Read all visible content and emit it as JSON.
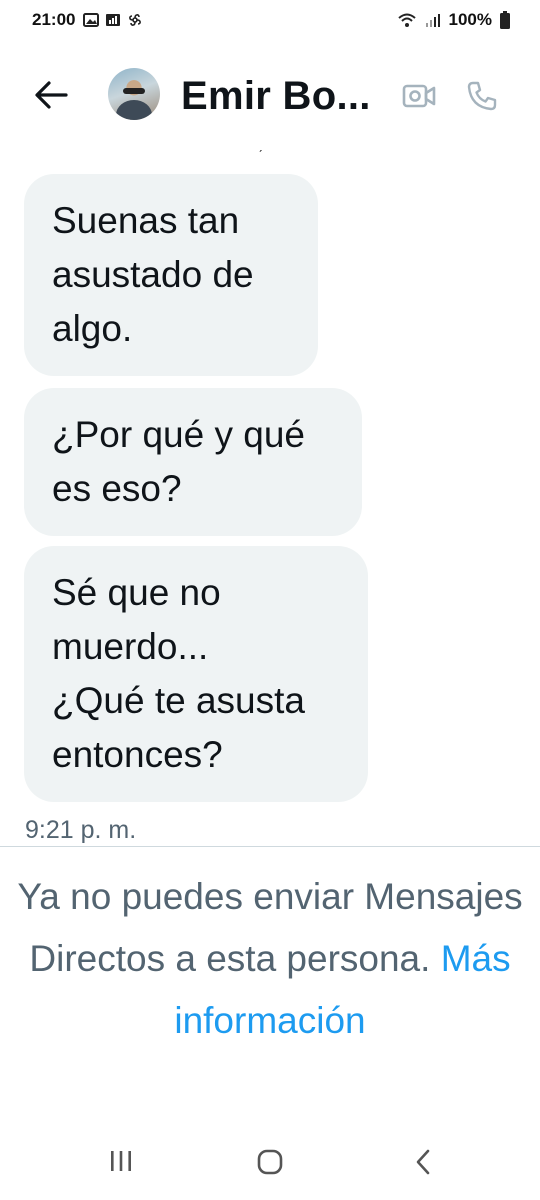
{
  "status_bar": {
    "time": "21:00",
    "battery": "100%",
    "left_icons": [
      "image-icon",
      "signal-bars-icon",
      "pinwheel-icon"
    ],
    "right_icons": [
      "wifi-icon",
      "signal-icon",
      "battery-icon"
    ]
  },
  "header": {
    "contact_name": "Emir Bo...",
    "icons": [
      "back-arrow-icon",
      "avatar",
      "video-call-icon",
      "phone-call-icon"
    ]
  },
  "messages": [
    {
      "text": "Suenas tan\nasustado de\nalgo."
    },
    {
      "text": "¿Por qué y qué\nes eso?"
    },
    {
      "text": "Sé que no\nmuerdo...\n¿Qué te asusta\nentonces?"
    }
  ],
  "timestamp": "9:21 p. m.",
  "notice": {
    "text": "Ya no puedes enviar Mensajes Directos a esta persona.",
    "link": "Más información"
  },
  "colors": {
    "accent": "#1d9bf0",
    "bubble": "#eff3f4",
    "secondary_text": "#536471",
    "text": "#0f1419"
  }
}
